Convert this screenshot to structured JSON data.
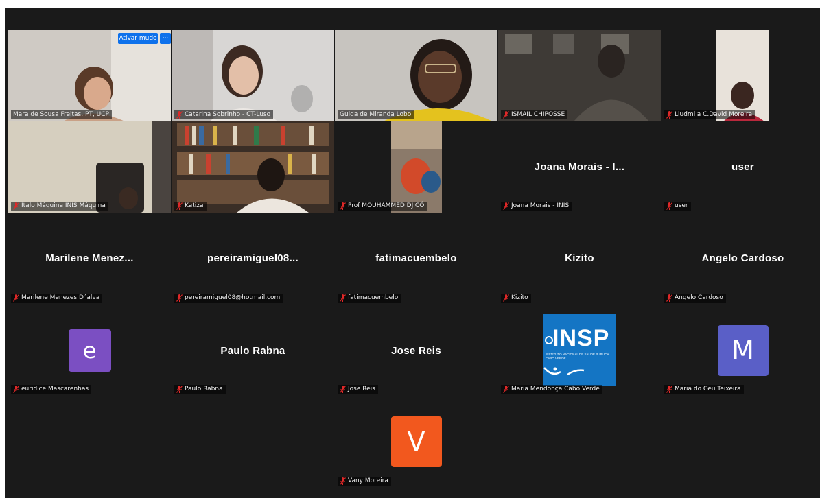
{
  "controls": {
    "unmute_button": "Ativar mudo",
    "more_button": "···"
  },
  "participants": [
    {
      "name": "Mara de Sousa Freitas, PT, UCP",
      "muted": false
    },
    {
      "name": "Catarina Sobrinho - CT-Luso",
      "muted": true
    },
    {
      "name": "Guida de Miranda Lobo",
      "muted": false
    },
    {
      "name": "ISMAIL CHIPOSSE",
      "muted": true
    },
    {
      "name": "Liudmila C.David Moreira",
      "muted": true
    },
    {
      "name": "Ítalo Máquina INIS Máquina",
      "muted": true
    },
    {
      "name": "Katiza",
      "muted": true
    },
    {
      "name": "Prof MOUHAMMED DJICÓ",
      "muted": true
    },
    {
      "name": "Joana Morais - INIS",
      "display": "Joana Morais - I...",
      "muted": true
    },
    {
      "name": "user",
      "display": "user",
      "muted": true
    },
    {
      "name": "Marilene Menezes D´alva",
      "display": "Marilene Menez...",
      "muted": true
    },
    {
      "name": "pereiramiguel08@hotmail.com",
      "display": "pereiramiguel08...",
      "muted": true
    },
    {
      "name": "fatimacuembelo",
      "display": "fatimacuembelo",
      "muted": true
    },
    {
      "name": "Kizito",
      "display": "Kizito",
      "muted": true
    },
    {
      "name": "Angelo Cardoso",
      "display": "Angelo Cardoso",
      "muted": true
    },
    {
      "name": "euridice Mascarenhas",
      "avatar_letter": "e",
      "muted": true
    },
    {
      "name": "Paulo Rabna",
      "display": "Paulo Rabna",
      "muted": true
    },
    {
      "name": "Jose Reis",
      "display": "Jose Reis",
      "muted": true
    },
    {
      "name": "Maria Mendonça Cabo Verde",
      "logo_text": "INSP",
      "logo_subtitle": "INSTITUTO NACIONAL DE SAÚDE PÚBLICA",
      "logo_sub2": "CABO VERDE",
      "muted": true
    },
    {
      "name": "Maria do Ceu Teixeira",
      "avatar_letter": "M",
      "muted": true
    },
    {
      "name": "Vany Moreira",
      "avatar_letter": "V",
      "muted": true
    }
  ],
  "colors": {
    "background": "#1a1a1a",
    "active_speaker_border": "#23d959",
    "mute_icon": "#e02828",
    "button_blue": "#0e71eb",
    "avatar_e": "#7b4fc2",
    "avatar_m": "#5a5fc7",
    "avatar_v": "#f2581e",
    "insp_blue": "#1475c4"
  }
}
